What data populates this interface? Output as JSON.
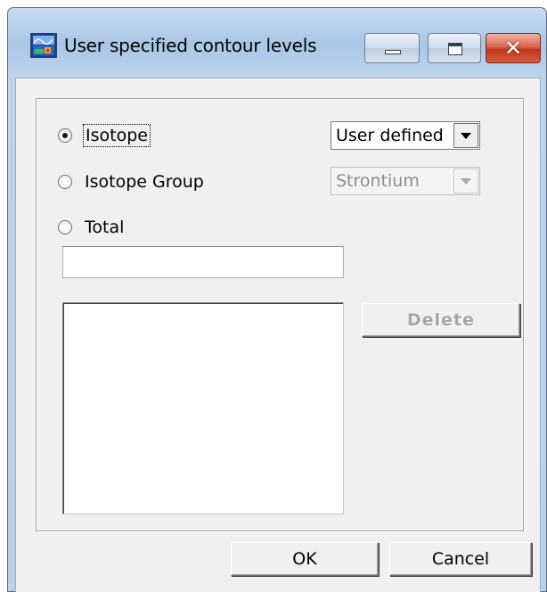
{
  "window": {
    "title": "User specified contour levels"
  },
  "mode": {
    "options": [
      {
        "label": "Isotope",
        "checked": true
      },
      {
        "label": "Isotope Group",
        "checked": false
      },
      {
        "label": "Total",
        "checked": false
      }
    ]
  },
  "isotope_combo": {
    "value": "User defined",
    "enabled": true
  },
  "group_combo": {
    "value": "Strontium",
    "enabled": false
  },
  "level_input": {
    "value": ""
  },
  "levels_list": {
    "items": []
  },
  "buttons": {
    "delete_label": "Delete",
    "ok_label": "OK",
    "cancel_label": "Cancel"
  },
  "icons": {
    "app": "contour-app-icon",
    "minimize": "minimize-icon",
    "maximize": "maximize-icon",
    "close": "close-icon",
    "dropdown": "chevron-down-icon"
  },
  "colors": {
    "titlebar": "#b9d1ea",
    "client": "#f0f0f0",
    "close_button": "#c1391c"
  }
}
